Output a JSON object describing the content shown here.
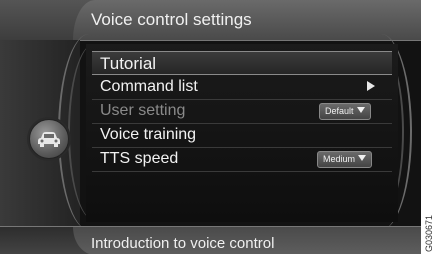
{
  "header": {
    "title": "Voice control settings"
  },
  "menu": {
    "items": [
      {
        "label": "Tutorial",
        "state": "selected"
      },
      {
        "label": "Command list",
        "state": "normal"
      },
      {
        "label": "User setting",
        "state": "disabled",
        "value": "Default"
      },
      {
        "label": "Voice training",
        "state": "normal"
      },
      {
        "label": "TTS speed",
        "state": "normal",
        "value": "Medium"
      }
    ]
  },
  "footer": {
    "text": "Introduction to voice control"
  },
  "left_button": {
    "icon": "car-icon"
  },
  "image_code": "G030671"
}
